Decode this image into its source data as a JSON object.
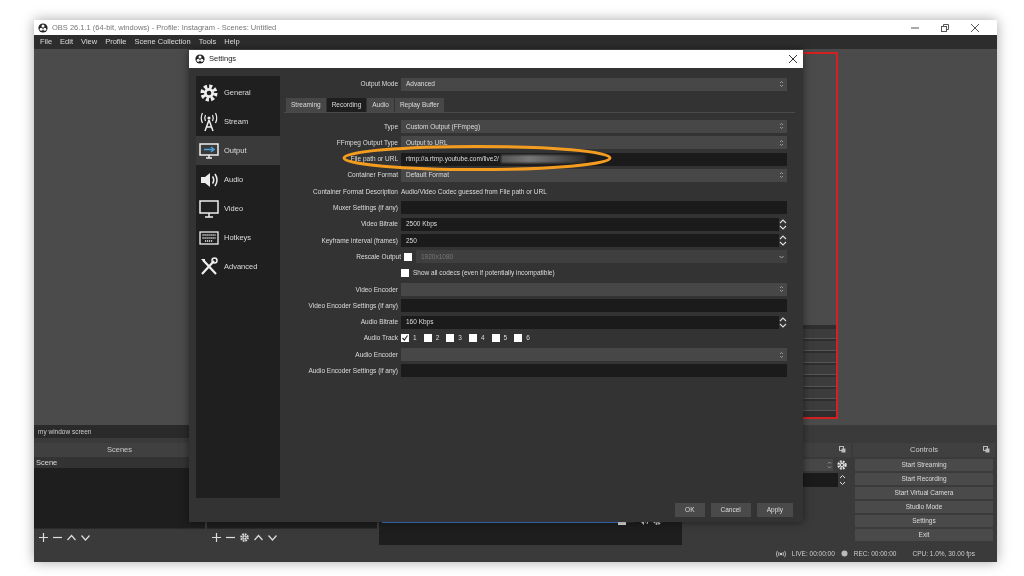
{
  "window": {
    "title": "OBS 26.1.1 (64-bit, windows) - Profile: Instagram - Scenes: Untitled"
  },
  "menu": [
    "File",
    "Edit",
    "View",
    "Profile",
    "Scene Collection",
    "Tools",
    "Help"
  ],
  "source_label": "my window screen",
  "mixer": {
    "level": 0.97
  },
  "scenes": {
    "header": "Scenes",
    "items": [
      {
        "label": "Scene",
        "selected": true
      }
    ]
  },
  "controls": {
    "header": "Controls",
    "buttons": [
      "Start Streaming",
      "Start Recording",
      "Start Virtual Camera",
      "Studio Mode",
      "Settings",
      "Exit"
    ]
  },
  "status_bar": {
    "live": "LIVE: 00:00:00",
    "rec": "REC: 00:00:00",
    "cpu": "CPU: 1.0%, 30.00 fps"
  },
  "settings": {
    "title": "Settings",
    "sidebar": [
      {
        "label": "General",
        "selected": false
      },
      {
        "label": "Stream",
        "selected": false
      },
      {
        "label": "Output",
        "selected": true
      },
      {
        "label": "Audio",
        "selected": false
      },
      {
        "label": "Video",
        "selected": false
      },
      {
        "label": "Hotkeys",
        "selected": false
      },
      {
        "label": "Advanced",
        "selected": false
      }
    ],
    "output_mode": {
      "label": "Output Mode",
      "value": "Advanced"
    },
    "tabs": [
      {
        "label": "Streaming",
        "selected": false
      },
      {
        "label": "Recording",
        "selected": true
      },
      {
        "label": "Audio",
        "selected": false
      },
      {
        "label": "Replay Buffer",
        "selected": false
      }
    ],
    "rows": [
      {
        "kind": "select",
        "label": "Type",
        "value": "Custom Output (FFmpeg)"
      },
      {
        "kind": "select",
        "label": "FFmpeg Output Type",
        "value": "Output to URL"
      },
      {
        "kind": "input",
        "label": "File path or URL",
        "value": "rtmp://a.rtmp.youtube.com/live2/",
        "highlighted": true
      },
      {
        "kind": "select",
        "label": "Container Format",
        "value": "Default Format"
      },
      {
        "kind": "text",
        "label": "Container Format Description",
        "value": "Audio/Video Codec guessed from File path or URL"
      },
      {
        "kind": "input",
        "label": "Muxer Settings (if any)"
      },
      {
        "kind": "spin",
        "label": "Video Bitrate",
        "value": "2500 Kbps"
      },
      {
        "kind": "spin",
        "label": "Keyframe interval (frames)",
        "value": "250"
      },
      {
        "kind": "rescale",
        "label": "Rescale Output",
        "checked": false,
        "disabled": true,
        "value": "1920x1080"
      },
      {
        "kind": "checkbox",
        "text": "Show all codecs (even if potentially incompatible)",
        "checked": false
      },
      {
        "kind": "select",
        "label": "Video Encoder"
      },
      {
        "kind": "input",
        "label": "Video Encoder Settings (if any)"
      },
      {
        "kind": "spin",
        "label": "Audio Bitrate",
        "value": "160 Kbps"
      },
      {
        "kind": "tracks",
        "label": "Audio Track",
        "tracks": [
          {
            "label": "1",
            "checked": true
          },
          {
            "label": "2",
            "checked": false
          },
          {
            "label": "3",
            "checked": false
          },
          {
            "label": "4",
            "checked": false
          },
          {
            "label": "5",
            "checked": false
          },
          {
            "label": "6",
            "checked": false
          }
        ]
      },
      {
        "kind": "select",
        "label": "Audio Encoder"
      },
      {
        "kind": "input",
        "label": "Audio Encoder Settings (if any)"
      }
    ],
    "buttons": [
      "OK",
      "Cancel",
      "Apply"
    ]
  }
}
